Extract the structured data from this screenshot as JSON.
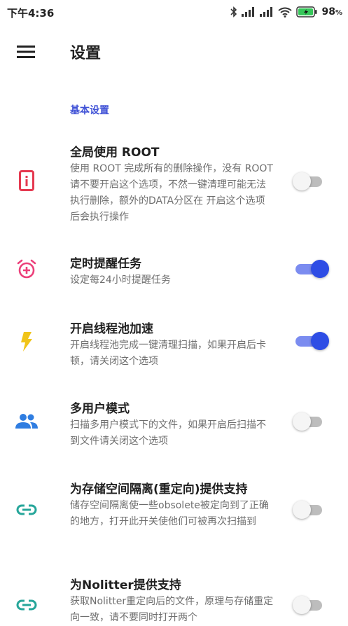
{
  "status_bar": {
    "time": "下午4:36",
    "battery_percent": "98",
    "battery_unit": "%",
    "icons": [
      "bluetooth-icon",
      "signal-icon",
      "signal-icon",
      "wifi-icon",
      "battery-charging-icon"
    ]
  },
  "app_bar": {
    "menu_icon": "hamburger-menu-icon",
    "title": "设置"
  },
  "section": {
    "header": "基本设置"
  },
  "colors": {
    "accent": "#3f51d6",
    "root_icon": "#e53950",
    "alarm_icon": "#ec407a",
    "bolt_icon": "#f0c419",
    "people_icon": "#2f7de1",
    "link_icon": "#26a69a",
    "toggle_on": "#2e4de5"
  },
  "settings": [
    {
      "icon": "phone-info-icon",
      "title": "全局使用 ROOT",
      "description": "使用 ROOT 完成所有的删除操作，没有 ROOT 请不要开启这个选项，不然一键清理可能无法执行删除，额外的DATA分区在 开启这个选项后会执行操作",
      "enabled": false
    },
    {
      "icon": "alarm-add-icon",
      "title": "定时提醒任务",
      "description": "设定每24小时提醒任务",
      "enabled": true
    },
    {
      "icon": "flash-icon",
      "title": "开启线程池加速",
      "description": "开启线程池完成一键清理扫描，如果开启后卡顿，请关闭这个选项",
      "enabled": true
    },
    {
      "icon": "people-icon",
      "title": "多用户模式",
      "description": "扫描多用户模式下的文件，如果开启后扫描不到文件请关闭这个选项",
      "enabled": false
    },
    {
      "icon": "link-icon",
      "title": "为存储空间隔离(重定向)提供支持",
      "description": "储存空间隔离使一些obsolete被定向到了正确的地方，打开此开关使他们可被再次扫描到",
      "enabled": false
    },
    {
      "icon": "link-icon",
      "title": "为Nolitter提供支持",
      "description": "获取Nolitter重定向后的文件，原理与存储重定向一致，请不要同时打开两个",
      "enabled": false
    }
  ]
}
